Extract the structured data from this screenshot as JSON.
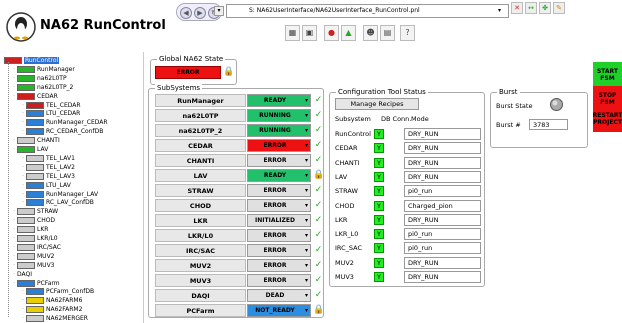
{
  "app": {
    "title": "NA62 RunControl"
  },
  "pathbar": {
    "path": "S: NA62UserInterface/NA62UserInterface_RunControl.pnl"
  },
  "tree": [
    {
      "label": "RunControl",
      "color": "#cc2020",
      "level": 0,
      "selected": true
    },
    {
      "label": "RunManager",
      "color": "#2ab42a",
      "level": 1
    },
    {
      "label": "na62L0TP",
      "color": "#2ab42a",
      "level": 1
    },
    {
      "label": "na62L0TP_2",
      "color": "#2ab42a",
      "level": 1
    },
    {
      "label": "CEDAR",
      "color": "#cc2020",
      "level": 1
    },
    {
      "label": "TEL_CEDAR",
      "color": "#cc2020",
      "level": 2
    },
    {
      "label": "LTU_CEDAR",
      "color": "#2b7fd4",
      "level": 2
    },
    {
      "label": "RunManager_CEDAR",
      "color": "#2b7fd4",
      "level": 2
    },
    {
      "label": "RC_CEDAR_ConfDB",
      "color": "#2b7fd4",
      "level": 2
    },
    {
      "label": "CHANTI",
      "color": "#cccccc",
      "level": 1
    },
    {
      "label": "LAV",
      "color": "#2ab42a",
      "level": 1
    },
    {
      "label": "TEL_LAV1",
      "color": "#cccccc",
      "level": 2
    },
    {
      "label": "TEL_LAV2",
      "color": "#cccccc",
      "level": 2
    },
    {
      "label": "TEL_LAV3",
      "color": "#cccccc",
      "level": 2
    },
    {
      "label": "LTU_LAV",
      "color": "#2b7fd4",
      "level": 2
    },
    {
      "label": "RunManager_LAV",
      "color": "#2b7fd4",
      "level": 2
    },
    {
      "label": "RC_LAV_ConfDB",
      "color": "#2b7fd4",
      "level": 2
    },
    {
      "label": "STRAW",
      "color": "#cccccc",
      "level": 1
    },
    {
      "label": "CHOD",
      "color": "#cccccc",
      "level": 1
    },
    {
      "label": "LKR",
      "color": "#cccccc",
      "level": 1
    },
    {
      "label": "LKR/L0",
      "color": "#cccccc",
      "level": 1
    },
    {
      "label": "IRC/SAC",
      "color": "#cccccc",
      "level": 1
    },
    {
      "label": "MUV2",
      "color": "#cccccc",
      "level": 1
    },
    {
      "label": "MUV3",
      "color": "#cccccc",
      "level": 1
    },
    {
      "label": "DAQI",
      "color": "",
      "level": 1
    },
    {
      "label": "PCFarm",
      "color": "#2b7fd4",
      "level": 1
    },
    {
      "label": "PCFarm_ConfDB",
      "color": "#2b7fd4",
      "level": 2
    },
    {
      "label": "NA62FARM6",
      "color": "#e8d000",
      "level": 2
    },
    {
      "label": "NA62FARM2",
      "color": "#e8d000",
      "level": 2
    },
    {
      "label": "NA62MERGER",
      "color": "#cccccc",
      "level": 2
    }
  ],
  "global_state": {
    "title": "Global NA62 State",
    "value": "ERROR",
    "color": "#ee1111"
  },
  "subsystems": {
    "title": "SubSystems",
    "rows": [
      {
        "name": "RunManager",
        "state": "READY",
        "color": "#22c06a",
        "icon": "check"
      },
      {
        "name": "na62L0TP",
        "state": "RUNNING",
        "color": "#22c06a",
        "icon": "check"
      },
      {
        "name": "na62L0TP_2",
        "state": "RUNNING",
        "color": "#22c06a",
        "icon": "check"
      },
      {
        "name": "CEDAR",
        "state": "ERROR",
        "color": "#ee1111",
        "icon": "check"
      },
      {
        "name": "CHANTI",
        "state": "ERROR",
        "color": "#e0e0e0",
        "icon": "check"
      },
      {
        "name": "LAV",
        "state": "READY",
        "color": "#22c06a",
        "icon": "lock"
      },
      {
        "name": "STRAW",
        "state": "ERROR",
        "color": "#e0e0e0",
        "icon": "check"
      },
      {
        "name": "CHOD",
        "state": "ERROR",
        "color": "#e0e0e0",
        "icon": "check"
      },
      {
        "name": "LKR",
        "state": "INITIALIZED",
        "color": "#e0e0e0",
        "icon": "check"
      },
      {
        "name": "LKR/L0",
        "state": "ERROR",
        "color": "#e0e0e0",
        "icon": "check"
      },
      {
        "name": "IRC/SAC",
        "state": "ERROR",
        "color": "#e0e0e0",
        "icon": "check"
      },
      {
        "name": "MUV2",
        "state": "ERROR",
        "color": "#e0e0e0",
        "icon": "check"
      },
      {
        "name": "MUV3",
        "state": "ERROR",
        "color": "#e0e0e0",
        "icon": "check"
      },
      {
        "name": "DAQI",
        "state": "DEAD",
        "color": "#e0e0e0",
        "icon": "check"
      },
      {
        "name": "PCFarm",
        "state": "NOT_READY",
        "color": "#2b8ee0",
        "icon": "lock"
      }
    ]
  },
  "config": {
    "title": "Configuration Tool Status",
    "manage_label": "Manage Recipes",
    "col_subsystem": "Subsystem",
    "col_db": "DB Conn.",
    "col_mode": "Mode",
    "db_mark": "Y",
    "rows": [
      {
        "name": "RunControl",
        "mode": "DRY_RUN"
      },
      {
        "name": "CEDAR",
        "mode": "DRY_RUN"
      },
      {
        "name": "CHANTI",
        "mode": "DRY_RUN"
      },
      {
        "name": "LAV",
        "mode": "DRY_RUN"
      },
      {
        "name": "STRAW",
        "mode": "pi0_run"
      },
      {
        "name": "CHOD",
        "mode": "Charged_pion"
      },
      {
        "name": "LKR",
        "mode": "DRY_RUN"
      },
      {
        "name": "LKR_L0",
        "mode": "pi0_run"
      },
      {
        "name": "IRC_SAC",
        "mode": "pi0_run"
      },
      {
        "name": "MUV2",
        "mode": "DRY_RUN"
      },
      {
        "name": "MUV3",
        "mode": "DRY_RUN"
      }
    ]
  },
  "burst": {
    "title": "Burst",
    "state_label": "Burst State",
    "number_label": "Burst #",
    "number": "3783"
  },
  "side_buttons": {
    "start": "START FSM",
    "stop": "STOP FSM",
    "restart": "RESTART PROJECT"
  }
}
